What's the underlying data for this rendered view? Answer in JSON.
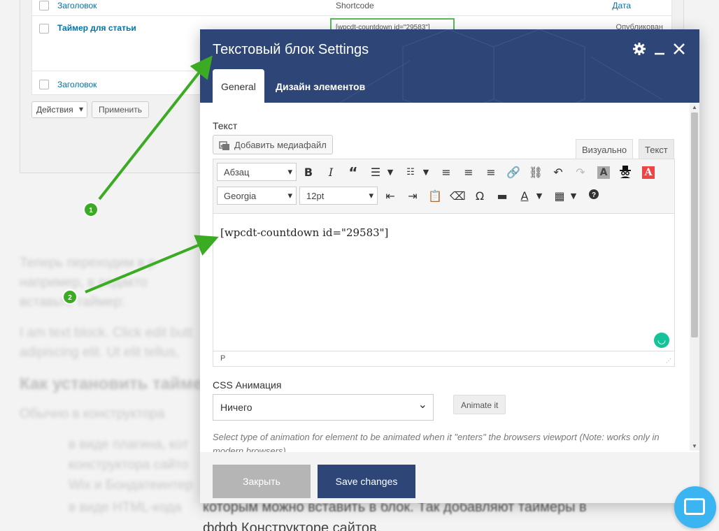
{
  "background": {
    "table": {
      "header": {
        "title_col": "Заголовок",
        "shortcode_col": "Shortcode",
        "date_col": "Дата"
      },
      "row": {
        "title": "Таймер для статьи",
        "shortcode": "[wpcdt-countdown id=\"29583\"]",
        "status": "Опубликован"
      },
      "footer": {
        "title_col": "Заголовок"
      }
    },
    "bulk": {
      "action": "Действия",
      "apply": "Применить"
    },
    "page_lines": [
      "Теперь переходим в р",
      "например, в редакто",
      "вставьте таймер:",
      "I am text block. Click edit butt",
      "adipiscing elit. Ut elit tellus,"
    ],
    "heading": "Как установить тайме",
    "heading_sub": "Обычно в конструктора",
    "bullets": [
      "в виде плагина, кот",
      "конструктора сайто",
      "Wix и Бондатеинтер",
      "в виде HTML-кода"
    ],
    "below_dialog": [
      "которым можно вставить в блок. Так добавляют таймеры в",
      "ффф Конструкторе сайтов."
    ]
  },
  "dialog": {
    "title": "Текстовый блок Settings",
    "tabs": [
      "General",
      "Дизайн элементов"
    ],
    "text_label": "Текст",
    "media_button": "Добавить медиафайл",
    "mode_tabs": {
      "visual": "Визуально",
      "text": "Текст"
    },
    "toolbar": {
      "format": "Абзац",
      "font": "Georgia",
      "size": "12pt"
    },
    "content": "[wpcdt-countdown id=\"29583\"]",
    "status_path": "P",
    "css_label": "CSS Анимация",
    "css_value": "Ничего",
    "animate_button": "Animate it",
    "help_text": "Select type of animation for element to be animated when it \"enters\" the browsers viewport (Note: works only in modern browsers).",
    "close_button": "Закрыть",
    "save_button": "Save changes"
  },
  "annotations": [
    "1",
    "2"
  ],
  "colors": {
    "header": "#2e4677",
    "arrow": "#3cab24",
    "link": "#0073aa"
  }
}
